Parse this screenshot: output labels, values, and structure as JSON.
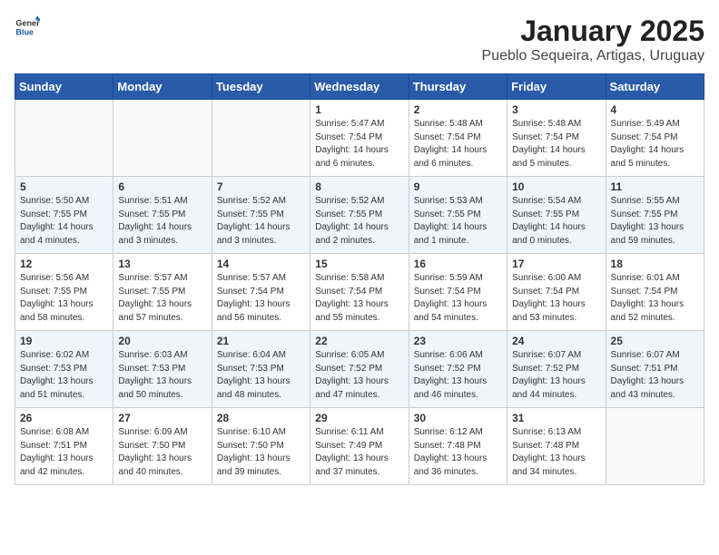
{
  "header": {
    "logo_general": "General",
    "logo_blue": "Blue",
    "month": "January 2025",
    "location": "Pueblo Sequeira, Artigas, Uruguay"
  },
  "weekdays": [
    "Sunday",
    "Monday",
    "Tuesday",
    "Wednesday",
    "Thursday",
    "Friday",
    "Saturday"
  ],
  "weeks": [
    [
      {
        "day": "",
        "info": ""
      },
      {
        "day": "",
        "info": ""
      },
      {
        "day": "",
        "info": ""
      },
      {
        "day": "1",
        "info": "Sunrise: 5:47 AM\nSunset: 7:54 PM\nDaylight: 14 hours\nand 6 minutes."
      },
      {
        "day": "2",
        "info": "Sunrise: 5:48 AM\nSunset: 7:54 PM\nDaylight: 14 hours\nand 6 minutes."
      },
      {
        "day": "3",
        "info": "Sunrise: 5:48 AM\nSunset: 7:54 PM\nDaylight: 14 hours\nand 5 minutes."
      },
      {
        "day": "4",
        "info": "Sunrise: 5:49 AM\nSunset: 7:54 PM\nDaylight: 14 hours\nand 5 minutes."
      }
    ],
    [
      {
        "day": "5",
        "info": "Sunrise: 5:50 AM\nSunset: 7:55 PM\nDaylight: 14 hours\nand 4 minutes."
      },
      {
        "day": "6",
        "info": "Sunrise: 5:51 AM\nSunset: 7:55 PM\nDaylight: 14 hours\nand 3 minutes."
      },
      {
        "day": "7",
        "info": "Sunrise: 5:52 AM\nSunset: 7:55 PM\nDaylight: 14 hours\nand 3 minutes."
      },
      {
        "day": "8",
        "info": "Sunrise: 5:52 AM\nSunset: 7:55 PM\nDaylight: 14 hours\nand 2 minutes."
      },
      {
        "day": "9",
        "info": "Sunrise: 5:53 AM\nSunset: 7:55 PM\nDaylight: 14 hours\nand 1 minute."
      },
      {
        "day": "10",
        "info": "Sunrise: 5:54 AM\nSunset: 7:55 PM\nDaylight: 14 hours\nand 0 minutes."
      },
      {
        "day": "11",
        "info": "Sunrise: 5:55 AM\nSunset: 7:55 PM\nDaylight: 13 hours\nand 59 minutes."
      }
    ],
    [
      {
        "day": "12",
        "info": "Sunrise: 5:56 AM\nSunset: 7:55 PM\nDaylight: 13 hours\nand 58 minutes."
      },
      {
        "day": "13",
        "info": "Sunrise: 5:57 AM\nSunset: 7:55 PM\nDaylight: 13 hours\nand 57 minutes."
      },
      {
        "day": "14",
        "info": "Sunrise: 5:57 AM\nSunset: 7:54 PM\nDaylight: 13 hours\nand 56 minutes."
      },
      {
        "day": "15",
        "info": "Sunrise: 5:58 AM\nSunset: 7:54 PM\nDaylight: 13 hours\nand 55 minutes."
      },
      {
        "day": "16",
        "info": "Sunrise: 5:59 AM\nSunset: 7:54 PM\nDaylight: 13 hours\nand 54 minutes."
      },
      {
        "day": "17",
        "info": "Sunrise: 6:00 AM\nSunset: 7:54 PM\nDaylight: 13 hours\nand 53 minutes."
      },
      {
        "day": "18",
        "info": "Sunrise: 6:01 AM\nSunset: 7:54 PM\nDaylight: 13 hours\nand 52 minutes."
      }
    ],
    [
      {
        "day": "19",
        "info": "Sunrise: 6:02 AM\nSunset: 7:53 PM\nDaylight: 13 hours\nand 51 minutes."
      },
      {
        "day": "20",
        "info": "Sunrise: 6:03 AM\nSunset: 7:53 PM\nDaylight: 13 hours\nand 50 minutes."
      },
      {
        "day": "21",
        "info": "Sunrise: 6:04 AM\nSunset: 7:53 PM\nDaylight: 13 hours\nand 48 minutes."
      },
      {
        "day": "22",
        "info": "Sunrise: 6:05 AM\nSunset: 7:52 PM\nDaylight: 13 hours\nand 47 minutes."
      },
      {
        "day": "23",
        "info": "Sunrise: 6:06 AM\nSunset: 7:52 PM\nDaylight: 13 hours\nand 46 minutes."
      },
      {
        "day": "24",
        "info": "Sunrise: 6:07 AM\nSunset: 7:52 PM\nDaylight: 13 hours\nand 44 minutes."
      },
      {
        "day": "25",
        "info": "Sunrise: 6:07 AM\nSunset: 7:51 PM\nDaylight: 13 hours\nand 43 minutes."
      }
    ],
    [
      {
        "day": "26",
        "info": "Sunrise: 6:08 AM\nSunset: 7:51 PM\nDaylight: 13 hours\nand 42 minutes."
      },
      {
        "day": "27",
        "info": "Sunrise: 6:09 AM\nSunset: 7:50 PM\nDaylight: 13 hours\nand 40 minutes."
      },
      {
        "day": "28",
        "info": "Sunrise: 6:10 AM\nSunset: 7:50 PM\nDaylight: 13 hours\nand 39 minutes."
      },
      {
        "day": "29",
        "info": "Sunrise: 6:11 AM\nSunset: 7:49 PM\nDaylight: 13 hours\nand 37 minutes."
      },
      {
        "day": "30",
        "info": "Sunrise: 6:12 AM\nSunset: 7:48 PM\nDaylight: 13 hours\nand 36 minutes."
      },
      {
        "day": "31",
        "info": "Sunrise: 6:13 AM\nSunset: 7:48 PM\nDaylight: 13 hours\nand 34 minutes."
      },
      {
        "day": "",
        "info": ""
      }
    ]
  ]
}
